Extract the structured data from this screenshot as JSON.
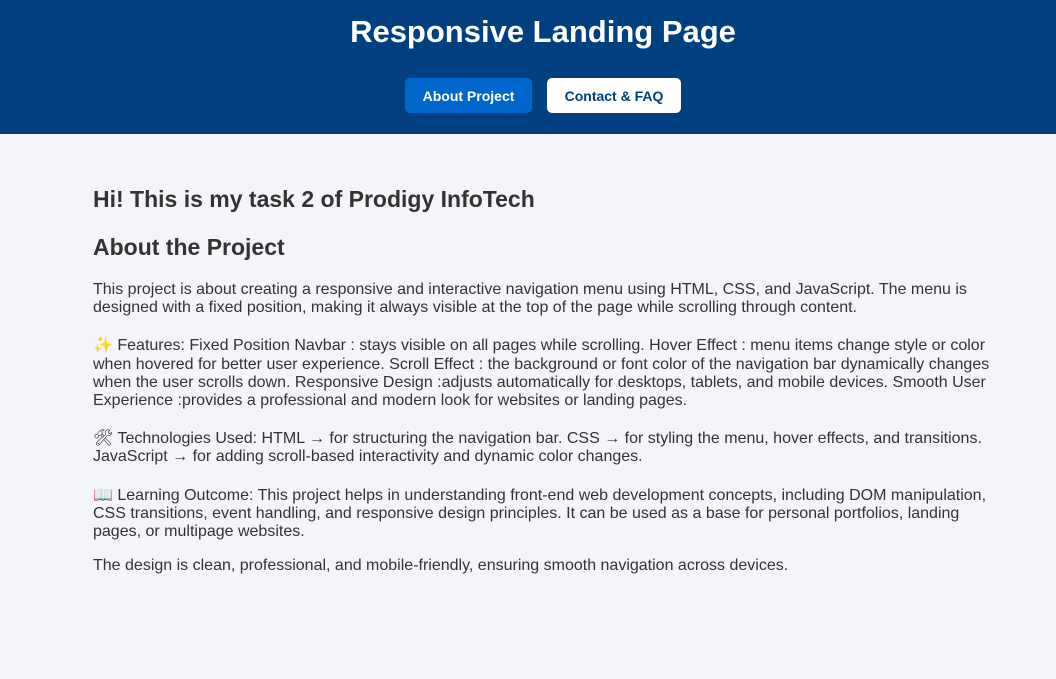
{
  "header": {
    "title": "Responsive Landing Page",
    "nav": [
      {
        "label": "About Project",
        "active": true
      },
      {
        "label": "Contact & FAQ",
        "active": false
      }
    ]
  },
  "main": {
    "greeting": "Hi! This is my task 2 of Prodigy InfoTech",
    "section_title": "About the Project",
    "intro": "This project is about creating a responsive and interactive navigation menu using HTML, CSS, and JavaScript. The menu is designed with a fixed position, making it always visible at the top of the page while scrolling through content.",
    "features_icon": "✨",
    "features": "Features: Fixed Position Navbar : stays visible on all pages while scrolling. Hover Effect : menu items change style or color when hovered for better user experience. Scroll Effect : the background or font color of the navigation bar dynamically changes when the user scrolls down. Responsive Design :adjusts automatically for desktops, tablets, and mobile devices. Smooth User Experience :provides a professional and modern look for websites or landing pages.",
    "tech_icon": "🛠",
    "technologies": "Technologies Used: HTML → for structuring the navigation bar. CSS → for styling the menu, hover effects, and transitions. JavaScript → for adding scroll-based interactivity and dynamic color changes.",
    "learning_icon": "📖",
    "learning": "Learning Outcome: This project helps in understanding front-end web development concepts, including DOM manipulation, CSS transitions, event handling, and responsive design principles. It can be used as a base for personal portfolios, landing pages, or multipage websites.",
    "closing": "The design is clean, professional, and mobile-friendly, ensuring smooth navigation across devices."
  },
  "colors": {
    "header_bg": "#004080",
    "active_button": "#0066cc",
    "page_bg": "#f3f5f9",
    "text": "#333333"
  }
}
